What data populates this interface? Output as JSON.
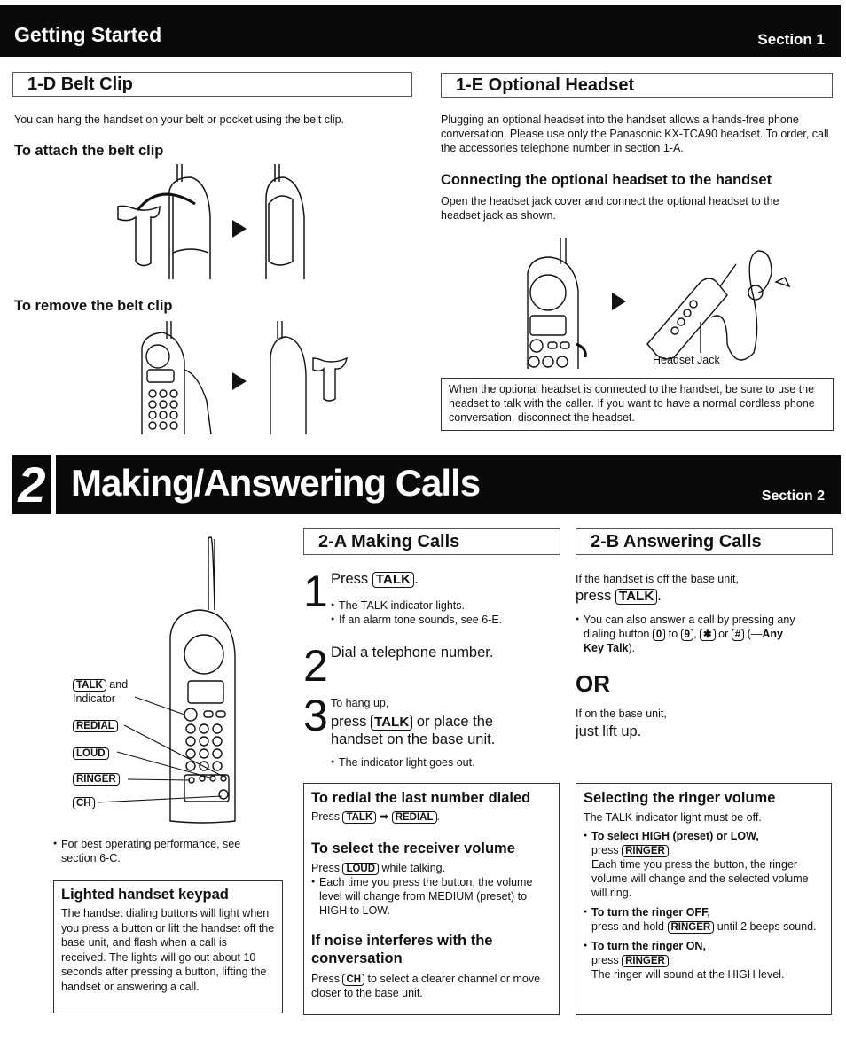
{
  "section1": {
    "header_title": "Getting Started",
    "header_section": "Section 1",
    "belt_clip": {
      "heading": "1-D  Belt Clip",
      "intro": "You can hang the handset on your belt or pocket using the belt clip.",
      "attach_heading": "To attach the belt clip",
      "remove_heading": "To remove the belt clip"
    },
    "headset": {
      "heading": "1-E  Optional Headset",
      "intro": "Plugging an optional headset into the handset allows a hands-free phone conversation. Please use only the Panasonic KX-TCA90 headset. To order, call the accessories telephone number in section 1-A.",
      "connect_heading": "Connecting the optional headset to the handset",
      "connect_text": "Open the headset jack cover and connect the optional headset to the headset jack as shown.",
      "jack_label": "Headset Jack",
      "note": "When the optional headset is connected to the handset, be sure to use the headset to talk with the caller. If you want to have a normal cordless phone conversation, disconnect the headset."
    }
  },
  "section2": {
    "number": "2",
    "header_title": "Making/Answering Calls",
    "header_section": "Section 2",
    "phone_labels": {
      "talk_key": "TALK",
      "talk_suffix": "and",
      "talk_line2": "Indicator",
      "redial": "REDIAL",
      "loud": "LOUD",
      "ringer": "RINGER",
      "ch": "CH"
    },
    "performance_note": "For best operating performance, see section 6-C.",
    "keypad_box": {
      "heading": "Lighted handset keypad",
      "text": "The handset dialing buttons will light when you press a button or lift the handset off the base unit, and flash when a call is received. The lights will go out about 10 seconds after pressing a button, lifting the handset or answering a call."
    },
    "making": {
      "heading": "2-A  Making Calls",
      "step1": {
        "num": "1",
        "pre": "Press",
        "key": "TALK",
        "post": ".",
        "bullets": [
          "The TALK indicator lights.",
          "If an alarm tone sounds, see 6-E."
        ]
      },
      "step2": {
        "num": "2",
        "text": "Dial a telephone number."
      },
      "step3": {
        "num": "3",
        "small": "To hang up,",
        "pre": "press",
        "key": "TALK",
        "post": "or place the handset on the base unit.",
        "bullets": [
          "The indicator light goes out."
        ]
      }
    },
    "answering": {
      "heading": "2-B  Answering Calls",
      "line1": "If the handset is off the base unit,",
      "press_pre": "press",
      "press_key": "TALK",
      "bullet_pre": "You can also answer a call by pressing any dialing button",
      "key0": "0",
      "to": "to",
      "key9": "9",
      "keystar": "✱",
      "or": "or",
      "keyhash": "#",
      "anykey": "Any Key Talk",
      "or_big": "OR",
      "base_line1": "If on the base unit,",
      "base_line2": "just lift up."
    },
    "redial_box": {
      "redial_heading": "To redial the last number dialed",
      "redial_pre": "Press",
      "redial_key1": "TALK",
      "redial_arrow": "➡",
      "redial_key2": "REDIAL",
      "volume_heading": "To select the receiver volume",
      "volume_pre": "Press",
      "volume_key": "LOUD",
      "volume_post": "while talking.",
      "volume_bullet": "Each time you press the button, the volume level will change from MEDIUM (preset) to HIGH to LOW.",
      "noise_heading": "If noise interferes with the conversation",
      "noise_pre": "Press",
      "noise_key": "CH",
      "noise_post": "to select a clearer channel or move closer to the base unit."
    },
    "ringer_box": {
      "heading": "Selecting the ringer volume",
      "intro": "The TALK indicator light must be off.",
      "items": [
        {
          "bold": "To select HIGH (preset) or LOW,",
          "pre": "press",
          "key": "RINGER",
          "post": ".",
          "extra": "Each time you press the button, the ringer volume will change and the selected volume will ring."
        },
        {
          "bold": "To turn the ringer OFF,",
          "pre": "press and hold",
          "key": "RINGER",
          "post": "until 2 beeps sound.",
          "extra": ""
        },
        {
          "bold": "To turn the ringer ON,",
          "pre": "press",
          "key": "RINGER",
          "post": ".",
          "extra": "The ringer will sound at the HIGH level."
        }
      ]
    }
  }
}
